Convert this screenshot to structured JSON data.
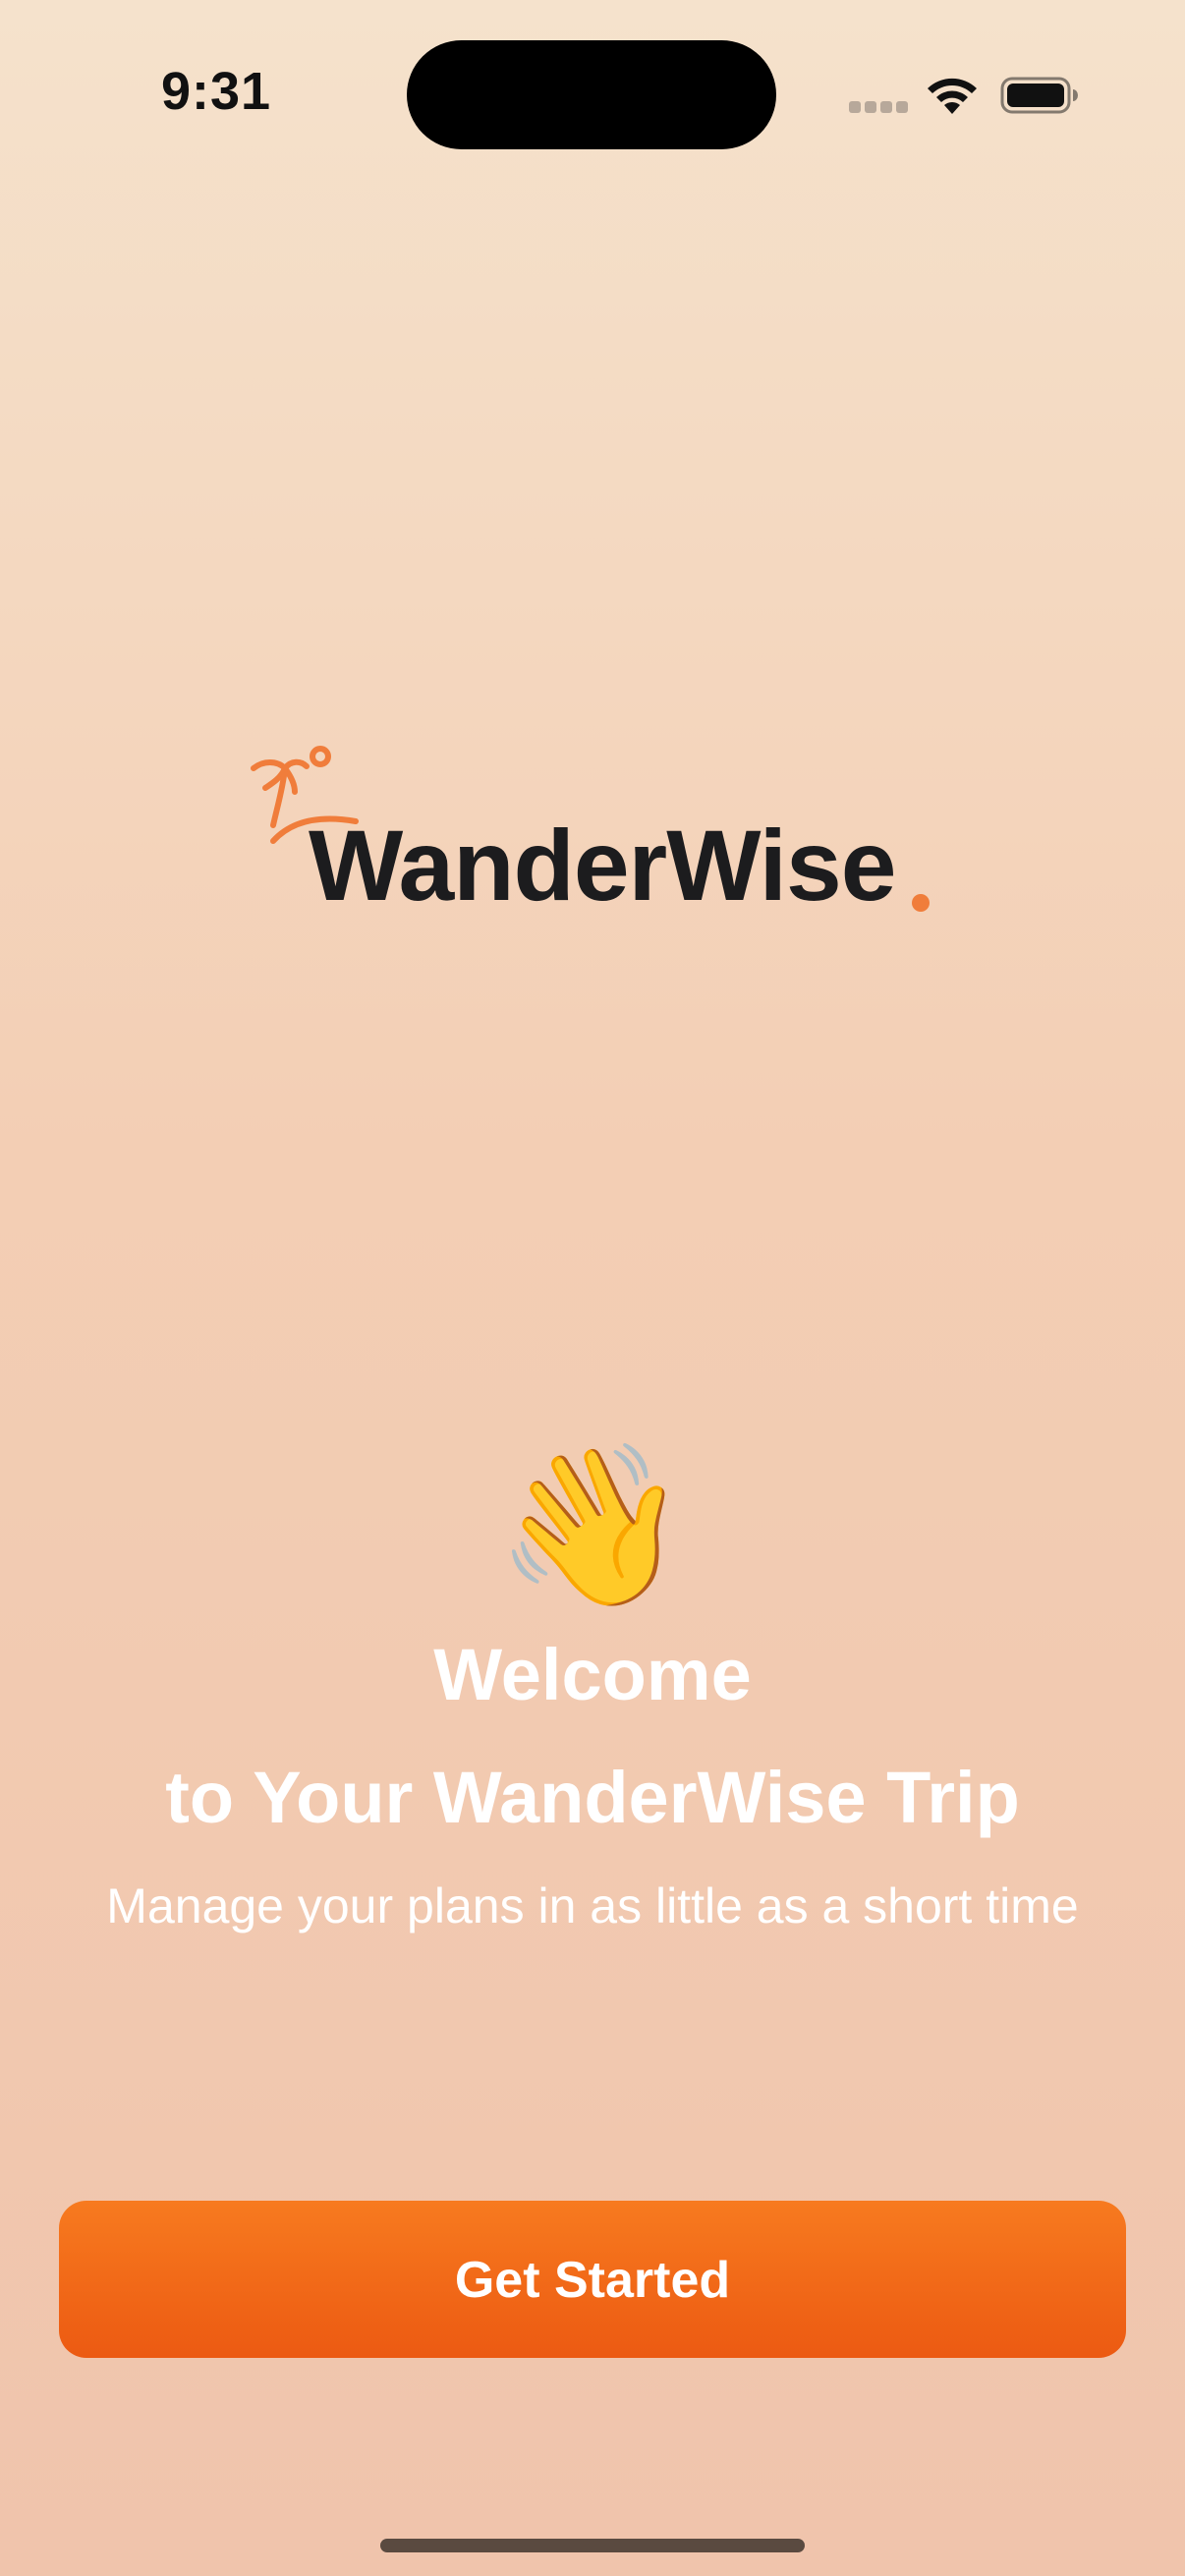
{
  "status_bar": {
    "time": "9:31",
    "icons": [
      "signal-icon",
      "wifi-icon",
      "battery-icon"
    ]
  },
  "logo": {
    "wordmark": "WanderWise",
    "icon": "palm-tree-island-icon",
    "accent_color": "#f07d3b"
  },
  "welcome": {
    "emoji": "👋",
    "title": "Welcome",
    "subtitle": "to Your WanderWise Trip",
    "tagline": "Manage your plans in as little as a short time"
  },
  "cta": {
    "label": "Get Started",
    "color": "#f26a18"
  }
}
